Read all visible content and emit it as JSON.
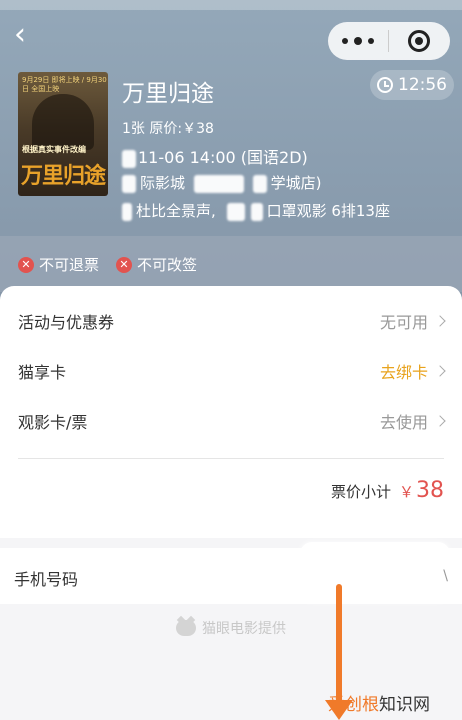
{
  "header": {
    "back_icon": "chevron-left-icon",
    "capsule": {
      "more_icon": "more-dots-icon",
      "close_icon": "target-close-icon"
    }
  },
  "movie": {
    "poster_top_text": "9月29日 即将上映 / 9月30日 全国上映",
    "poster_mid_text": "根据真实事件改编",
    "poster_title": "万里归途",
    "title": "万里归途",
    "timer": "12:56",
    "price_line": "1张 原价:￥38",
    "time_line": "11-06 14:00 (国语2D)",
    "cinema_line": "际影城",
    "cinema_line_tail": "学城店)",
    "seat_line_head": "杜比全景声,",
    "seat_line_tail": "口罩观影 6排13座"
  },
  "tags": [
    {
      "icon": "x-circle-icon",
      "label": "不可退票"
    },
    {
      "icon": "x-circle-icon",
      "label": "不可改签"
    }
  ],
  "options": [
    {
      "label": "活动与优惠券",
      "value": "无可用",
      "accent": false
    },
    {
      "label": "猫享卡",
      "value": "去绑卡",
      "accent": true
    },
    {
      "label": "观影卡/票",
      "value": "去使用",
      "accent": false
    }
  ],
  "subtotal": {
    "label": "票价小计",
    "currency": "￥",
    "amount": "38"
  },
  "phone": {
    "label": "手机号码",
    "edge": "\\"
  },
  "provider": {
    "icon": "maoyan-cat-icon",
    "text": "猫眼电影提供"
  },
  "watermark": {
    "brand": "爱创根",
    "suffix": "知识网"
  },
  "colors": {
    "accent_red": "#e2534f",
    "accent_orange": "#e8a31d",
    "arrow": "#f07a2a"
  }
}
